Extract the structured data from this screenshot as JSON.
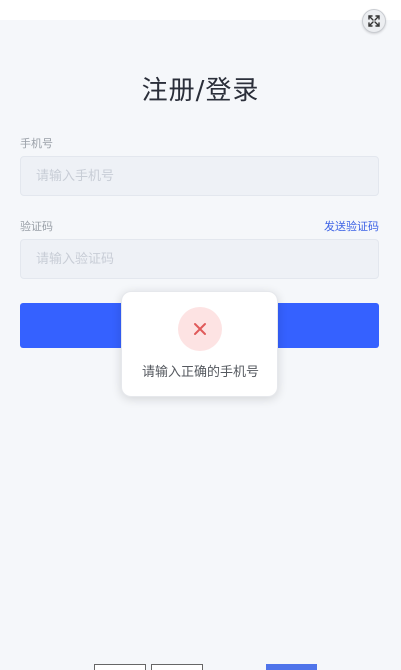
{
  "header": {
    "fullscreen_icon": "expand-arrows-icon"
  },
  "form": {
    "title": "注册/登录",
    "phone": {
      "label": "手机号",
      "placeholder": "请输入手机号",
      "value": ""
    },
    "code": {
      "label": "验证码",
      "placeholder": "请输入验证码",
      "value": "",
      "send_link": "发送验证码"
    },
    "submit_label": ""
  },
  "toast": {
    "icon": "close-x-icon",
    "message": "请输入正确的手机号"
  },
  "colors": {
    "accent": "#3561ff",
    "link": "#3d63e6",
    "error": "#e05a5a"
  }
}
